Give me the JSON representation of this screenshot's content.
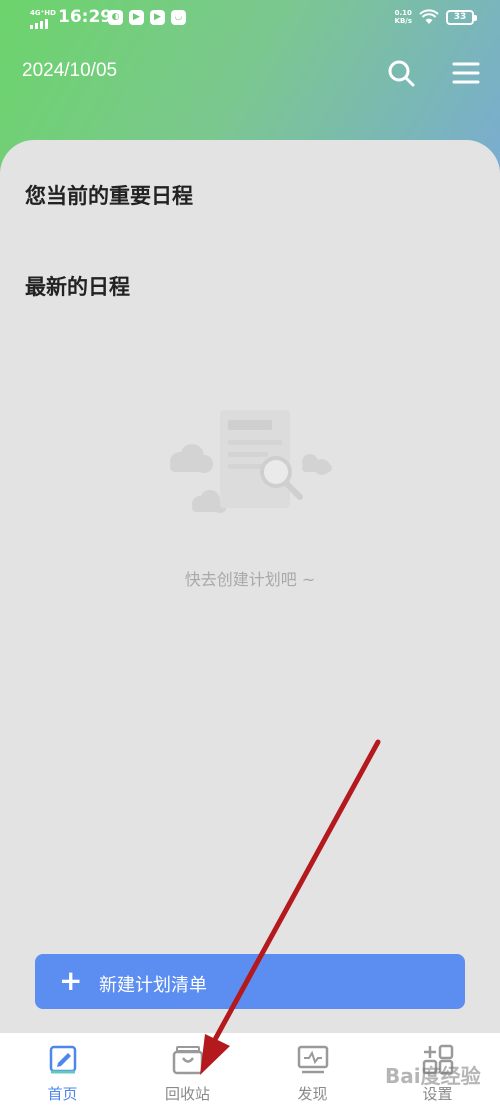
{
  "status_bar": {
    "network": "4G⁺HD",
    "time": "16:29",
    "app_icons": [
      "message-icon",
      "play-icon",
      "play-icon",
      "chat-icon"
    ],
    "net_speed_value": "0.10",
    "net_speed_unit": "KB/s",
    "battery": "33"
  },
  "header": {
    "date": "2024/10/05",
    "search_icon": "search-icon",
    "menu_icon": "menu-icon"
  },
  "main": {
    "important_title": "您当前的重要日程",
    "latest_title": "最新的日程",
    "empty_text": "快去创建计划吧 ~"
  },
  "new_button": {
    "plus": "+",
    "label": "新建计划清单"
  },
  "bottom_nav": {
    "items": [
      {
        "label": "首页",
        "icon": "home-edit-icon",
        "active": true
      },
      {
        "label": "回收站",
        "icon": "recycle-bin-icon",
        "active": false
      },
      {
        "label": "发现",
        "icon": "discover-icon",
        "active": false
      },
      {
        "label": "设置",
        "icon": "settings-grid-icon",
        "active": false
      }
    ]
  },
  "watermark": "Bai度经验",
  "colors": {
    "accent": "#5c8df0",
    "nav_active": "#4f86ec",
    "gradient_start": "#6cd46b",
    "gradient_end": "#7aaad6",
    "annotation_arrow": "#b3191d"
  }
}
